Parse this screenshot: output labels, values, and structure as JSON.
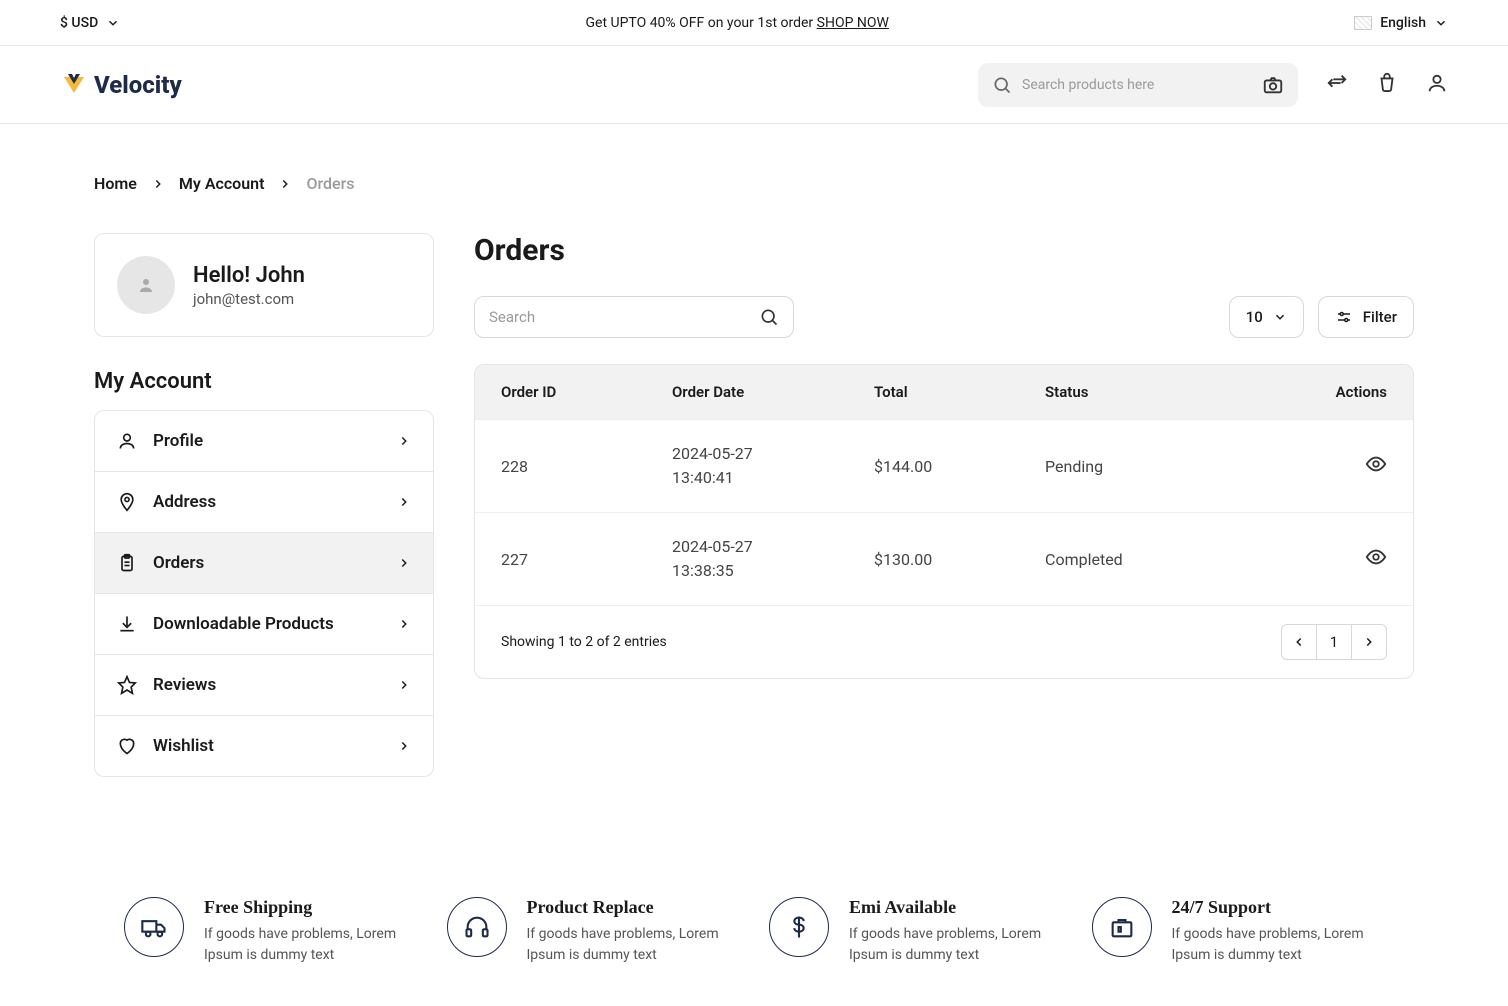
{
  "topbar": {
    "currency": "$ USD",
    "promo_prefix": "Get UPTO 40% OFF on your 1st order ",
    "promo_link": "SHOP NOW",
    "language": "English"
  },
  "header": {
    "brand": "Velocity",
    "search_placeholder": "Search products here"
  },
  "breadcrumbs": [
    "Home",
    "My Account",
    "Orders"
  ],
  "profile": {
    "greeting": "Hello! John",
    "email": "john@test.com"
  },
  "sidebar": {
    "title": "My Account",
    "items": [
      {
        "label": "Profile"
      },
      {
        "label": "Address"
      },
      {
        "label": "Orders",
        "active": true
      },
      {
        "label": "Downloadable Products"
      },
      {
        "label": "Reviews"
      },
      {
        "label": "Wishlist"
      }
    ]
  },
  "orders_page": {
    "title": "Orders",
    "search_placeholder": "Search",
    "page_size": "10",
    "filter_label": "Filter",
    "columns": [
      "Order ID",
      "Order Date",
      "Total",
      "Status",
      "Actions"
    ],
    "rows": [
      {
        "id": "228",
        "date_line1": "2024-05-27",
        "date_line2": "13:40:41",
        "total": "$144.00",
        "status": "Pending"
      },
      {
        "id": "227",
        "date_line1": "2024-05-27",
        "date_line2": "13:38:35",
        "total": "$130.00",
        "status": "Completed"
      }
    ],
    "showing": "Showing 1 to 2 of 2 entries",
    "current_page": "1"
  },
  "features": [
    {
      "title": "Free Shipping",
      "desc": "If goods have problems, Lorem Ipsum is dummy text"
    },
    {
      "title": "Product Replace",
      "desc": "If goods have problems, Lorem Ipsum is dummy text"
    },
    {
      "title": "Emi Available",
      "desc": "If goods have problems, Lorem Ipsum is dummy text"
    },
    {
      "title": "24/7 Support",
      "desc": "If goods have problems, Lorem Ipsum is dummy text"
    }
  ]
}
